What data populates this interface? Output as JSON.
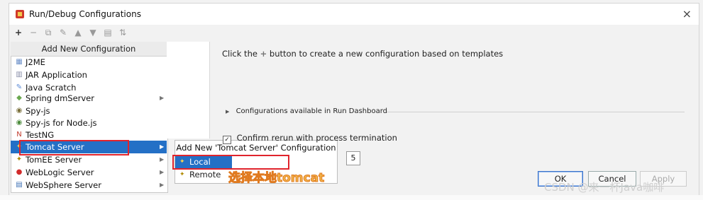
{
  "window": {
    "title": "Run/Debug Configurations",
    "close_glyph": "×"
  },
  "toolbar": {
    "buttons": [
      {
        "name": "add",
        "glyph": "+"
      },
      {
        "name": "remove",
        "glyph": "−"
      },
      {
        "name": "copy",
        "glyph": "⧉"
      },
      {
        "name": "edit",
        "glyph": "✎"
      },
      {
        "name": "move-up",
        "glyph": "▲"
      },
      {
        "name": "move-down",
        "glyph": "▼"
      },
      {
        "name": "folder",
        "glyph": "▤"
      },
      {
        "name": "sort",
        "glyph": "⇅"
      }
    ]
  },
  "popup": {
    "header": "Add New Configuration",
    "items": [
      {
        "label": "J2ME",
        "icon": "j2me-icon",
        "glyph": "▦",
        "color": "#6a8fc8",
        "has_submenu": false
      },
      {
        "label": "JAR Application",
        "icon": "jar-icon",
        "glyph": "▥",
        "color": "#8a8fa8",
        "has_submenu": false
      },
      {
        "label": "Java Scratch",
        "icon": "java-scratch-icon",
        "glyph": "✎",
        "color": "#5b8bd6",
        "has_submenu": false
      },
      {
        "label": "Spring dmServer",
        "icon": "spring-icon",
        "glyph": "◆",
        "color": "#6aa84f",
        "has_submenu": true
      },
      {
        "label": "Spy-js",
        "icon": "spyjs-icon",
        "glyph": "◉",
        "color": "#7a6f3a",
        "has_submenu": false
      },
      {
        "label": "Spy-js for Node.js",
        "icon": "spyjs-node-icon",
        "glyph": "◉",
        "color": "#4b8b3b",
        "has_submenu": false
      },
      {
        "label": "TestNG",
        "icon": "testng-icon",
        "glyph": "N",
        "color": "#c0392b",
        "has_submenu": false
      },
      {
        "label": "Tomcat Server",
        "icon": "tomcat-icon",
        "glyph": "✦",
        "color": "#d9a400",
        "has_submenu": true,
        "selected": true
      },
      {
        "label": "TomEE Server",
        "icon": "tomee-icon",
        "glyph": "✦",
        "color": "#b08a00",
        "has_submenu": true
      },
      {
        "label": "WebLogic Server",
        "icon": "weblogic-icon",
        "glyph": "●",
        "color": "#d12b2b",
        "has_submenu": true
      },
      {
        "label": "WebSphere Server",
        "icon": "websphere-icon",
        "glyph": "▤",
        "color": "#3e6fb3",
        "has_submenu": true
      }
    ],
    "submenu_arrow": "▶"
  },
  "submenu": {
    "header": "Add New 'Tomcat Server' Configuration",
    "items": [
      {
        "label": "Local",
        "icon": "tomcat-local-icon",
        "glyph": "✦",
        "selected": true
      },
      {
        "label": "Remote",
        "icon": "tomcat-remote-icon",
        "glyph": "✦",
        "selected": false
      }
    ]
  },
  "main": {
    "hint_before": "Click the",
    "hint_plus": "+",
    "hint_after": "button to create a new configuration based on templates",
    "dashboard": "Configurations available in Run Dashboard",
    "dashboard_arrow": "▶",
    "confirm_rerun": "Confirm rerun with process termination",
    "confirm_checked": "✓",
    "limit_value": "5"
  },
  "buttons": {
    "ok": "OK",
    "cancel": "Cancel",
    "apply": "Apply"
  },
  "annotation": {
    "text": "选择本地tomcat",
    "color": "#f2b54a"
  },
  "watermark": "CSDN @来一杯Java咖啡",
  "colors": {
    "selection": "#2470c6",
    "highlight_box": "#e0242c"
  }
}
